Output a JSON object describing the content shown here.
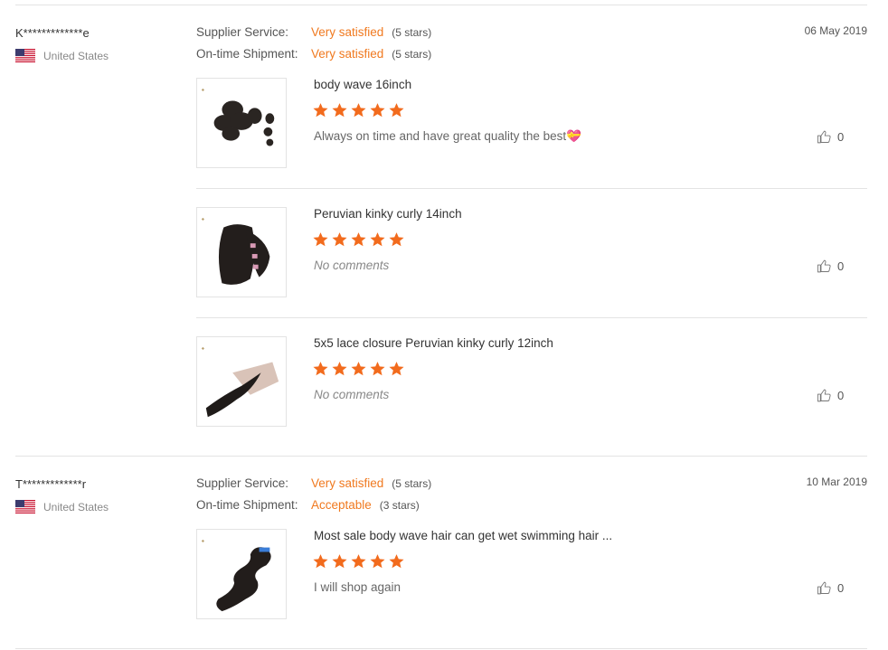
{
  "reviews": [
    {
      "user": "K*************e",
      "country": "United States",
      "date": "06 May 2019",
      "supplier_label": "Supplier Service:",
      "supplier_value": "Very satisfied",
      "supplier_stars": "(5 stars)",
      "shipment_label": "On-time Shipment:",
      "shipment_value": "Very satisfied",
      "shipment_stars": "(5 stars)",
      "items": [
        {
          "product": "body wave 16inch",
          "rating": 5,
          "comment": "Always on time and have great quality the best💝",
          "likes": "0"
        },
        {
          "product": "Peruvian kinky curly 14inch",
          "rating": 5,
          "comment": "No comments",
          "likes": "0"
        },
        {
          "product": "5x5 lace closure Peruvian kinky curly 12inch",
          "rating": 5,
          "comment": "No comments",
          "likes": "0"
        }
      ]
    },
    {
      "user": "T*************r",
      "country": "United States",
      "date": "10 Mar 2019",
      "supplier_label": "Supplier Service:",
      "supplier_value": "Very satisfied",
      "supplier_stars": "(5 stars)",
      "shipment_label": "On-time Shipment:",
      "shipment_value": "Acceptable",
      "shipment_stars": "(3 stars)",
      "items": [
        {
          "product": "Most sale body wave hair can get wet swimming hair ...",
          "rating": 5,
          "comment": "I will shop again",
          "likes": "0"
        }
      ]
    }
  ],
  "colors": {
    "accent": "#f0791f",
    "star": "#f26b1d",
    "divider": "#e3e3e3"
  },
  "icons": {
    "like": "thumbs-up-icon",
    "star": "star-icon",
    "flag": "us-flag-icon"
  }
}
